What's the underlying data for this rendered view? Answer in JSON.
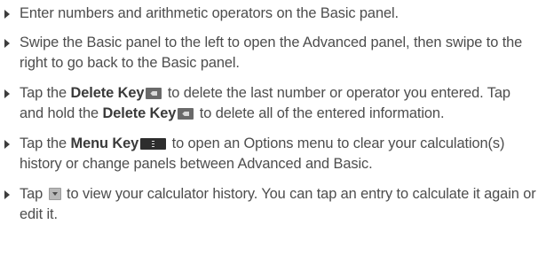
{
  "instructions": [
    {
      "text": "Enter numbers and arithmetic operators on the Basic panel."
    },
    {
      "text": "Swipe the Basic panel to the left to open the Advanced panel, then swipe to the right to go back to the Basic panel."
    },
    {
      "part1": "Tap the ",
      "key": "Delete Key",
      "part2": " to delete the last number or operator you entered. Tap and hold the ",
      "key2": "Delete Key",
      "part3": " to delete all of the entered information.",
      "icon": "delete-key-icon"
    },
    {
      "part1": "Tap the ",
      "key": "Menu Key",
      "part2": " to open an Options menu to clear your calculation(s) history or change panels between Advanced and Basic.",
      "icon": "menu-key-icon"
    },
    {
      "part1": "Tap ",
      "part2": " to view your calculator history. You can tap an entry to calculate it again or edit it.",
      "icon": "history-dropdown-icon"
    }
  ]
}
